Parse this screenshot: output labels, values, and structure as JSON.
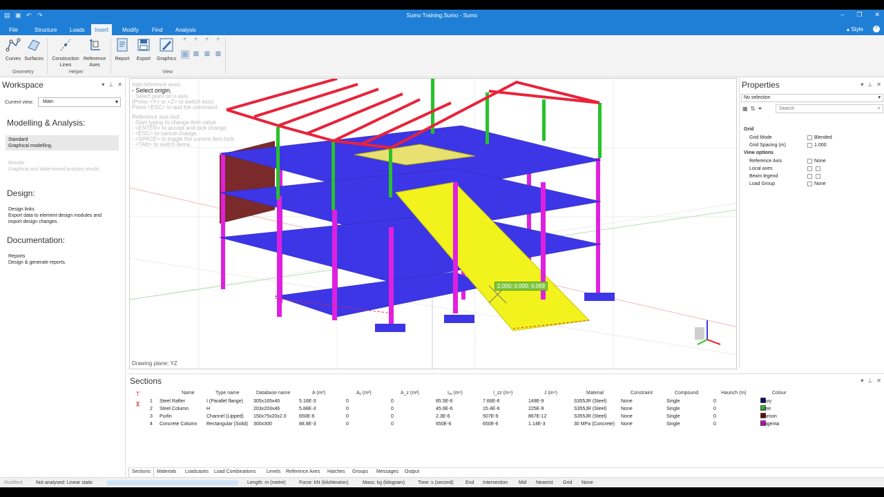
{
  "window": {
    "title": "Sumo Training.Sumo - Sumo",
    "controls": [
      "minimize",
      "restore",
      "close"
    ]
  },
  "ribbon": {
    "tabs": [
      "File",
      "Structure",
      "Loads",
      "Insert",
      "Modify",
      "Find",
      "Analysis"
    ],
    "active_tab": "Insert",
    "style_label": "Style",
    "groups": {
      "geometry": {
        "label": "Geometry",
        "buttons": [
          "Curves",
          "Surfaces"
        ]
      },
      "helper": {
        "label": "Helper",
        "buttons": [
          "Construction Lines",
          "Reference Axes"
        ]
      },
      "view": {
        "label": "View",
        "buttons": [
          "Report",
          "Export",
          "Graphics"
        ]
      }
    }
  },
  "workspace": {
    "title": "Workspace",
    "current_view_label": "Current view:",
    "current_view_value": "Main",
    "modelling": {
      "heading": "Modelling & Analysis:",
      "items": [
        {
          "title": "Standard",
          "desc": "Graphical modelling."
        },
        {
          "title": "Results",
          "desc": "Graphical and table-based analysis results."
        }
      ]
    },
    "design": {
      "heading": "Design:",
      "items": [
        {
          "title": "Design links",
          "desc": "Export data to element design modules and import design changes."
        }
      ]
    },
    "documentation": {
      "heading": "Documentation:",
      "items": [
        {
          "title": "Reports",
          "desc": "Design & generate reports."
        }
      ]
    }
  },
  "viewport": {
    "hints": [
      "Add reference axes:",
      "- Select origin.",
      "- Select point on x-axis.",
      "(Press <Y> or <Z> to switch axis)",
      "Press <ESC> to quit the command.",
      "",
      "Reference axis tool:",
      "- Start typing to change item value.",
      "- <ENTER> to accept and lock change.",
      "- <ESC> to cancel change.",
      "- <SPACE> to toggle the current item lock.",
      "- <TAB> to switch items."
    ],
    "coord_tooltip": "2.000; 0.000; 4.069",
    "drawing_plane": "Drawing plane: YZ",
    "colors": {
      "rafter": "#e8233a",
      "column_green": "#27c22a",
      "column_magenta": "#e020e0",
      "slab": "#3d36e6",
      "ramp": "#f2f21c",
      "wall": "#7a2a2a"
    }
  },
  "properties": {
    "title": "Properties",
    "selection": "No selection",
    "search_placeholder": "Search",
    "rows": [
      {
        "type": "cat",
        "key": "Grid"
      },
      {
        "type": "row",
        "key": "Grid Mode",
        "value": "Blended"
      },
      {
        "type": "row",
        "key": "Grid Spacing (m)",
        "value": "1.000"
      },
      {
        "type": "cat",
        "key": "View options"
      },
      {
        "type": "row",
        "key": "Reference Axis",
        "value": "None"
      },
      {
        "type": "row",
        "key": "Local axes",
        "value": ""
      },
      {
        "type": "row",
        "key": "Beam legend",
        "value": ""
      },
      {
        "type": "row",
        "key": "Load Group",
        "value": "None"
      }
    ]
  },
  "sections": {
    "title": "Sections",
    "columns": [
      "Name",
      "Type name",
      "Database name",
      "A (m²)",
      "Aᵧ (m²)",
      "A_z (m²)",
      "Iᵧᵧ (m⁴)",
      "I_zz (m⁴)",
      "J (m⁴)",
      "Material",
      "Constraint",
      "Compound",
      "Haunch (m)",
      "Colour"
    ],
    "rows": [
      {
        "n": "1",
        "name": "Steel Rafter",
        "type": "I (Parallel flange)",
        "db": "305x165x40",
        "a": "5.16E-3",
        "ay": "0",
        "az": "0",
        "iyy": "85.5E-6",
        "izz": "7.66E-6",
        "j": "149E-9",
        "material": "S355JR (Steel)",
        "constraint": "None",
        "compound": "Single",
        "haunch": "0",
        "colour": "Navy",
        "hex": "#000080"
      },
      {
        "n": "2",
        "name": "Steel Column",
        "type": "H",
        "db": "203x203x46",
        "a": "5.88E-3",
        "ay": "0",
        "az": "0",
        "iyy": "45.6E-6",
        "izz": "15.4E-6",
        "j": "225E-9",
        "material": "S355JR (Steel)",
        "constraint": "None",
        "compound": "Single",
        "haunch": "0",
        "colour": "Lime",
        "hex": "#32cd32"
      },
      {
        "n": "3",
        "name": "Purlin",
        "type": "Channel (Lipped)",
        "db": "150x75x20x2.0",
        "a": "650E-6",
        "ay": "0",
        "az": "0",
        "iyy": "2.3E-6",
        "izz": "507E-9",
        "j": "867E-12",
        "material": "S355JR (Steel)",
        "constraint": "None",
        "compound": "Single",
        "haunch": "0",
        "colour": "Maroon",
        "hex": "#800000"
      },
      {
        "n": "4",
        "name": "Concrete Column",
        "type": "Rectangular (Solid)",
        "db": "300x300",
        "a": "88.8E-3",
        "ay": "0",
        "az": "0",
        "iyy": "650E-6",
        "izz": "650E-6",
        "j": "1.14E-3",
        "material": "30 MPa (Concrete)",
        "constraint": "None",
        "compound": "Single",
        "haunch": "0",
        "colour": "Magenta",
        "hex": "#ff00ff"
      }
    ]
  },
  "bottom_tabs": [
    "Sections",
    "Materials",
    "Loadcases",
    "Load Combinations",
    "Levels",
    "Reference Axes",
    "Hatches",
    "Groups",
    "Messages",
    "Output"
  ],
  "status": {
    "modified": "Modified",
    "analysis": "Not analysed: Linear static",
    "length": "Length: m (metre)",
    "force": "Force: kN (kiloNewton)",
    "mass": "Mass: kg (kilogram)",
    "time": "Time: s (second)",
    "snaps": [
      "End",
      "Intersection",
      "Mid",
      "Nearest",
      "Grid",
      "None"
    ]
  }
}
